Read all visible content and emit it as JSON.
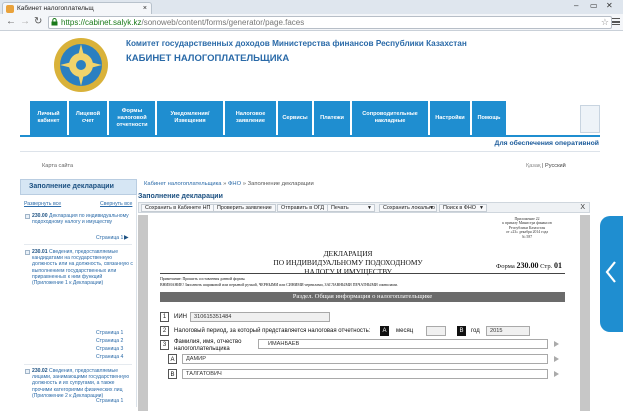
{
  "browser": {
    "tab_title": "Кабинет налогоплательщ",
    "url_host": "https://cabinet.salyk.kz",
    "url_path": "/sonoweb/content/forms/generator/page.faces"
  },
  "header": {
    "org": "Комитет государственных доходов Министерства финансов Республики Казахстан",
    "cabinet": "КАБИНЕТ НАЛОГОПЛАТЕЛЬЩИКА"
  },
  "nav": [
    {
      "line1": "Личный",
      "line2": "кабинет",
      "line3": ""
    },
    {
      "line1": "Лицевой",
      "line2": "счет",
      "line3": ""
    },
    {
      "line1": "Формы",
      "line2": "налоговой",
      "line3": "отчетности"
    },
    {
      "line1": "Уведомления/",
      "line2": "Извещения",
      "line3": ""
    },
    {
      "line1": "Налоговое",
      "line2": "заявление",
      "line3": ""
    },
    {
      "line1": "Сервисы",
      "line2": "",
      "line3": ""
    },
    {
      "line1": "Платежи",
      "line2": "",
      "line3": ""
    },
    {
      "line1": "Сопроводительные",
      "line2": "накладные",
      "line3": ""
    },
    {
      "line1": "Настройки",
      "line2": "",
      "line3": ""
    },
    {
      "line1": "Помощь",
      "line2": "",
      "line3": ""
    }
  ],
  "pension_link": "Для обеспечения оперативной",
  "sitemap": "Карта сайта",
  "lang": {
    "kz": "Қазақ",
    "sep": "|",
    "ru": "Русский"
  },
  "sidebar": {
    "title": "Заполнение декларации",
    "expand": "Развернуть все",
    "collapse": "Свернуть все",
    "items": [
      {
        "code": "230.00",
        "text": "Декларация по индивидуальному подоходному налогу и имуществу",
        "pages": [
          "Страница 1"
        ]
      },
      {
        "code": "230.01",
        "text": "Сведения, предоставляемые кандидатами на государственную должность или на должность, связанную с выполнением государственных или приравненных к ним функций (Приложение 1 к Декларации)",
        "pages": [
          "Страница 1",
          "Страница 2",
          "Страница 3",
          "Страница 4"
        ]
      },
      {
        "code": "230.02",
        "text": "Сведения, предоставляемые лицами, занимающими государственную должность и их супругами, а также прочими категориями физических лиц (Приложение 2 к Декларации)",
        "pages": [
          "Страница 1"
        ]
      }
    ]
  },
  "main": {
    "breadcrumb": {
      "a": "Кабинет налогоплательщика",
      "b": "ФНО",
      "c": "Заполнение декларации",
      "sep": "»"
    },
    "section_title": "Заполнение декларации",
    "toolbar": {
      "save": "Сохранить в Кабинете НП",
      "check": "Проверить заявление",
      "send": "Отправить в ОГД",
      "print": "Печать",
      "save_local": "Сохранить локально",
      "search": "Поиск в ФНО",
      "close": "X"
    }
  },
  "doc": {
    "appendix": [
      "Приложение 22",
      "к приказу Министра финансов",
      "Республики Казахстан",
      "от «23» декабря 2014 года",
      "№ 587"
    ],
    "title_l1": "ДЕКЛАРАЦИЯ",
    "title_l2": "ПО ИНДИВИДУАЛЬНОМУ ПОДОХОДНОМУ",
    "title_l3": "НАЛОГУ И ИМУЩЕСТВУ",
    "form_label": "Форма",
    "form_code": "230.00",
    "page_label": "Стр.",
    "page_num": "01",
    "note1": "Примечание: Прошить составления данной формы.",
    "note2": "ВНИМАНИЕ! Заполнить шариковой или перьевой ручкой, ЧЕРНЫМИ или СИНИМИ чернилами, ЗАГЛАВНЫМИ ПЕЧАТНЫМИ символами.",
    "section": "Раздел. Общая информация о налогоплательщике",
    "row1": {
      "num": "1",
      "label": "ИИН",
      "value": "310615351484"
    },
    "row2": {
      "num": "2",
      "label": "Налоговый период, за который представляется налоговая отчетность:",
      "a": "A",
      "month": "месяц",
      "b": "B",
      "year": "год",
      "year_value": "2015"
    },
    "row3": {
      "num": "3",
      "label1": "Фамилия, имя, отчество",
      "label2": "налогоплательщика",
      "surname": "ИМАНБАЕВ",
      "a": "A",
      "name": "ДАМИР",
      "b": "B",
      "patronymic": "ТАЛГАТОВИЧ"
    }
  }
}
